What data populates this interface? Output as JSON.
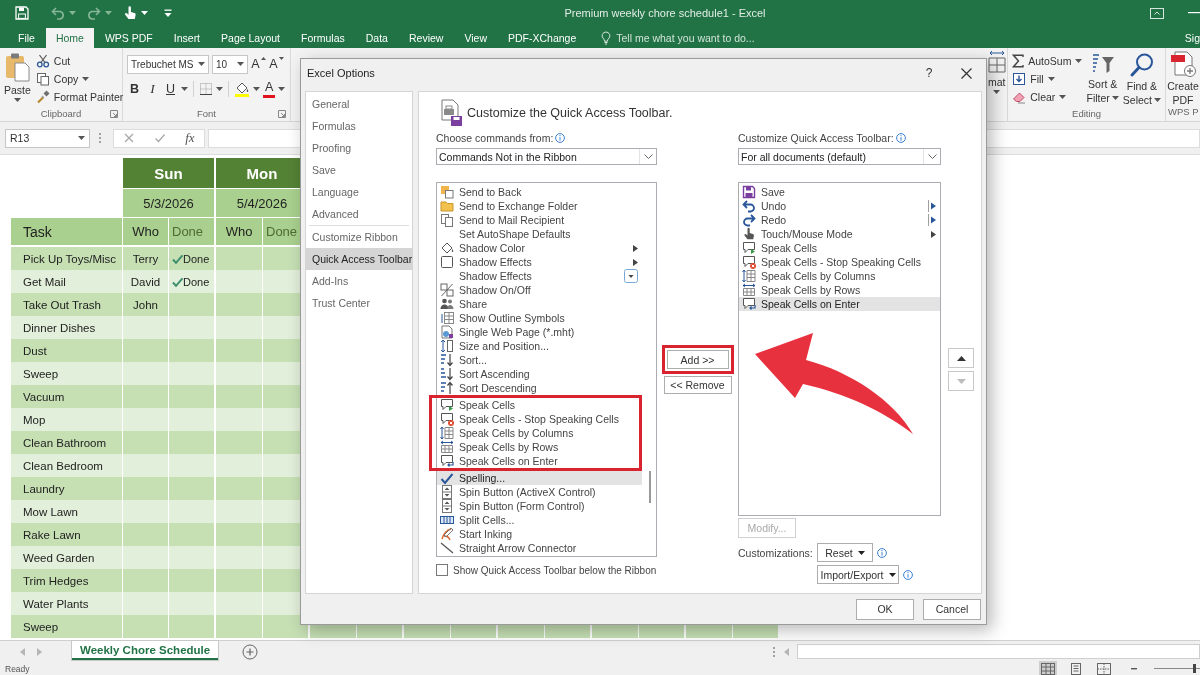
{
  "window": {
    "title": "Premium weekly chore schedule1 - Excel"
  },
  "quick_access_toolbar": [
    {
      "disabled": false
    },
    {
      "disabled": true
    },
    {
      "disabled": true
    },
    {
      "disabled": false
    }
  ],
  "tabs": [
    {
      "label": "File",
      "selected": false
    },
    {
      "label": "Home",
      "selected": true
    },
    {
      "label": "WPS PDF",
      "selected": false
    },
    {
      "label": "Insert",
      "selected": false
    },
    {
      "label": "Page Layout",
      "selected": false
    },
    {
      "label": "Formulas",
      "selected": false
    },
    {
      "label": "Data",
      "selected": false
    },
    {
      "label": "Review",
      "selected": false
    },
    {
      "label": "View",
      "selected": false
    },
    {
      "label": "PDF-XChange",
      "selected": false
    }
  ],
  "tell_me": {
    "placeholder": "Tell me what you want to do..."
  },
  "account": "Sig",
  "ribbon": {
    "clipboard": {
      "paste": "Paste",
      "cut": "Cut",
      "copy": "Copy",
      "format_painter": "Format Painter",
      "label": "Clipboard"
    },
    "font": {
      "name": "Trebuchet MS",
      "size": "10",
      "grow": "A",
      "shrink": "A",
      "bold": "B",
      "italic": "I",
      "underline": "U",
      "font_color_button": {
        "label": "A"
      },
      "label": "Font"
    },
    "cells": {
      "format": "mat"
    },
    "editing": {
      "autosum": "AutoSum",
      "fill": "Fill",
      "clear": "Clear",
      "sort_filter": [
        "Sort &",
        "Filter"
      ],
      "find_select": [
        "Find &",
        "Select"
      ],
      "label": "Editing"
    },
    "wps_pdf": {
      "create_pdf": [
        "Create",
        "PDF"
      ],
      "label": "WPS P"
    }
  },
  "formula_bar": {
    "name_box": "R13",
    "function": "fx"
  },
  "sheet": {
    "days": [
      {
        "day": "Sun",
        "date": "5/3/2026"
      },
      {
        "day": "Mon",
        "date": "5/4/2026"
      }
    ],
    "columns": [
      "Task",
      "Who",
      "Done",
      "Who",
      "Done"
    ],
    "rows": [
      {
        "task": "Pick Up Toys/Misc",
        "entries": [
          {
            "who": "Terry",
            "done": "Done"
          }
        ]
      },
      {
        "task": "Get Mail",
        "entries": [
          {
            "who": "David",
            "done": "Done"
          }
        ]
      },
      {
        "task": "Take Out Trash",
        "entries": [
          {
            "who": "John"
          }
        ]
      },
      {
        "task": "Dinner Dishes"
      },
      {
        "task": "Dust"
      },
      {
        "task": "Sweep"
      },
      {
        "task": "Vacuum"
      },
      {
        "task": "Mop"
      },
      {
        "task": "Clean Bathroom"
      },
      {
        "task": "Clean Bedroom"
      },
      {
        "task": "Laundry"
      },
      {
        "task": "Mow Lawn"
      },
      {
        "task": "Rake Lawn"
      },
      {
        "task": "Weed Garden"
      },
      {
        "task": "Trim Hedges"
      },
      {
        "task": "Water Plants"
      },
      {
        "task": "Sweep"
      }
    ]
  },
  "sheet_tabs": [
    {
      "label": "Weekly Chore Schedule",
      "selected": true
    }
  ],
  "status_bar": {
    "text": "Ready",
    "views": [
      {
        "selected": true
      },
      {
        "selected": false
      },
      {
        "selected": false
      }
    ],
    "zoom": {
      "level": 0.9
    }
  },
  "dialog": {
    "title": "Excel Options",
    "help": "?",
    "nav_groups": [
      [
        {
          "label": "General",
          "selected": false
        },
        {
          "label": "Formulas",
          "selected": false
        },
        {
          "label": "Proofing",
          "selected": false
        },
        {
          "label": "Save",
          "selected": false
        },
        {
          "label": "Language",
          "selected": false
        },
        {
          "label": "Advanced",
          "selected": false
        }
      ],
      [
        {
          "label": "Customize Ribbon",
          "selected": false
        },
        {
          "label": "Quick Access Toolbar",
          "selected": true
        },
        {
          "label": "Add-Ins",
          "selected": false
        },
        {
          "label": "Trust Center",
          "selected": false
        }
      ]
    ],
    "heading": "Customize the Quick Access Toolbar.",
    "choose_commands": {
      "label": "Choose commands from:",
      "value": "Commands Not in the Ribbon"
    },
    "commands": [
      {
        "label": "Send to Back",
        "kind": "plain",
        "selected": false,
        "highlighted": false
      },
      {
        "label": "Send to Exchange Folder",
        "kind": "plain",
        "selected": false,
        "highlighted": false
      },
      {
        "label": "Send to Mail Recipient",
        "kind": "plain",
        "selected": false,
        "highlighted": false
      },
      {
        "label": "Set AutoShape Defaults",
        "kind": "plain",
        "selected": false,
        "highlighted": false
      },
      {
        "label": "Shadow Color",
        "kind": "submenu",
        "selected": false,
        "highlighted": false
      },
      {
        "label": "Shadow Effects",
        "kind": "submenu",
        "selected": false,
        "highlighted": false
      },
      {
        "label": "Shadow Effects",
        "kind": "gallery",
        "selected": false,
        "highlighted": false
      },
      {
        "label": "Shadow On/Off",
        "kind": "plain",
        "selected": false,
        "highlighted": false
      },
      {
        "label": "Share",
        "kind": "plain",
        "selected": false,
        "highlighted": false
      },
      {
        "label": "Show Outline Symbols",
        "kind": "plain",
        "selected": false,
        "highlighted": false
      },
      {
        "label": "Single Web Page (*.mht)",
        "kind": "plain",
        "selected": false,
        "highlighted": false
      },
      {
        "label": "Size and Position...",
        "kind": "plain",
        "selected": false,
        "highlighted": false
      },
      {
        "label": "Sort...",
        "kind": "plain",
        "selected": false,
        "highlighted": false
      },
      {
        "label": "Sort Ascending",
        "kind": "plain",
        "selected": false,
        "highlighted": false
      },
      {
        "label": "Sort Descending",
        "kind": "plain",
        "selected": false,
        "highlighted": false
      },
      {
        "label": "Speak Cells",
        "kind": "plain",
        "selected": false,
        "highlighted": true
      },
      {
        "label": "Speak Cells - Stop Speaking Cells",
        "kind": "plain",
        "selected": false,
        "highlighted": true
      },
      {
        "label": "Speak Cells by Columns",
        "kind": "plain",
        "selected": false,
        "highlighted": true
      },
      {
        "label": "Speak Cells by Rows",
        "kind": "plain",
        "selected": false,
        "highlighted": true
      },
      {
        "label": "Speak Cells on Enter",
        "kind": "plain",
        "selected": false,
        "highlighted": true
      },
      {
        "label": "Spelling...",
        "kind": "plain",
        "selected": true,
        "highlighted": false
      },
      {
        "label": "Spin Button (ActiveX Control)",
        "kind": "plain",
        "selected": false,
        "highlighted": false
      },
      {
        "label": "Spin Button (Form Control)",
        "kind": "plain",
        "selected": false,
        "highlighted": false
      },
      {
        "label": "Split Cells...",
        "kind": "plain",
        "selected": false,
        "highlighted": false
      },
      {
        "label": "Start Inking",
        "kind": "plain",
        "selected": false,
        "highlighted": false
      },
      {
        "label": "Straight Arrow Connector",
        "kind": "plain",
        "selected": false,
        "highlighted": false
      }
    ],
    "add_button": {
      "label": "Add >>",
      "highlighted": true
    },
    "remove_button": {
      "label": "<< Remove"
    },
    "toolbar_scope": {
      "label": "Customize Quick Access Toolbar:",
      "value": "For all documents (default)"
    },
    "toolbar_commands": [
      {
        "label": "Save",
        "kind": "plain",
        "selected": false
      },
      {
        "label": "Undo",
        "kind": "split",
        "selected": false
      },
      {
        "label": "Redo",
        "kind": "split",
        "selected": false
      },
      {
        "label": "Touch/Mouse Mode",
        "kind": "submenu",
        "selected": false
      },
      {
        "label": "Speak Cells",
        "kind": "plain",
        "selected": false
      },
      {
        "label": "Speak Cells - Stop Speaking Cells",
        "kind": "plain",
        "selected": false
      },
      {
        "label": "Speak Cells by Columns",
        "kind": "plain",
        "selected": false
      },
      {
        "label": "Speak Cells by Rows",
        "kind": "plain",
        "selected": false
      },
      {
        "label": "Speak Cells on Enter",
        "kind": "plain",
        "selected": true
      }
    ],
    "move_buttons": [
      {
        "disabled": false
      },
      {
        "disabled": true
      }
    ],
    "modify_button": {
      "label": "Modify...",
      "disabled": true
    },
    "customizations_label": "Customizations:",
    "reset_button": "Reset",
    "import_export_button": "Import/Export",
    "below_ribbon": {
      "label": "Show Quick Access Toolbar below the Ribbon",
      "checked": false
    },
    "ok_button": "OK",
    "cancel_button": "Cancel",
    "pointer_arrow": true
  }
}
